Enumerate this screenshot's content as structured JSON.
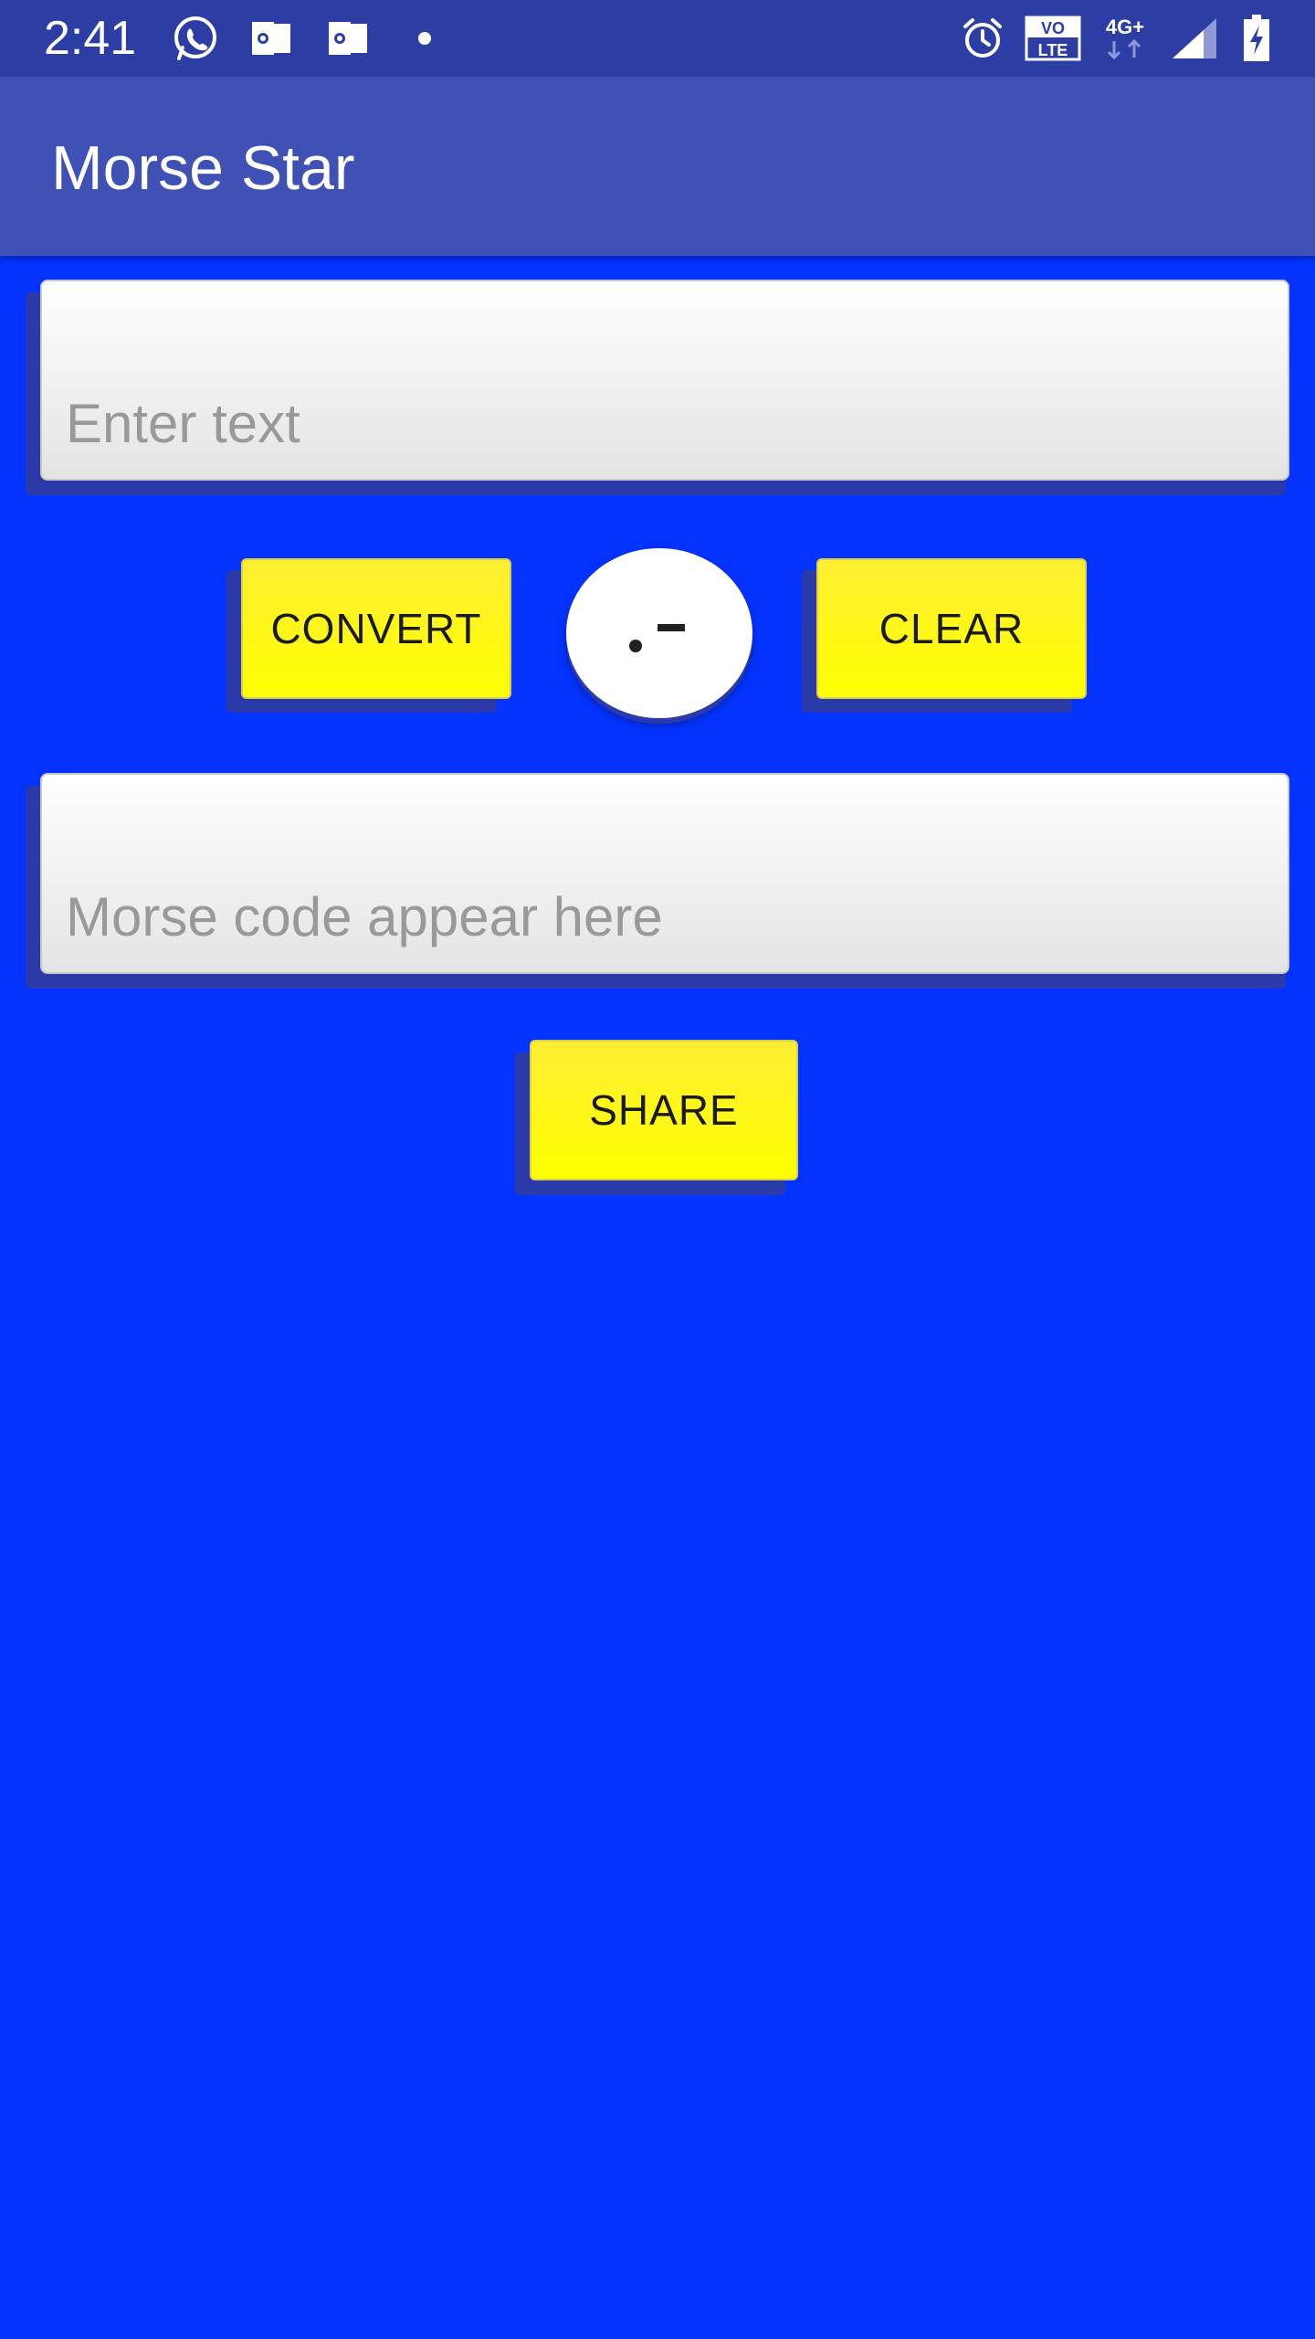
{
  "status_bar": {
    "time": "2:41",
    "icons": [
      "whatsapp-icon",
      "outlook-icon",
      "outlook-icon",
      "dot-icon",
      "alarm-icon",
      "volte-icon",
      "4g-plus-icon",
      "signal-icon",
      "battery-charging-icon"
    ],
    "volte_top": "VO",
    "volte_bottom": "LTE",
    "network": "4G+"
  },
  "app_bar": {
    "title": "Morse Star"
  },
  "input_field": {
    "value": "",
    "placeholder": "Enter text"
  },
  "buttons": {
    "convert_label": "CONVERT",
    "clear_label": "CLEAR",
    "share_label": "SHARE",
    "morse_toggle_icon": "dot-dash-icon"
  },
  "output_field": {
    "value": "",
    "placeholder": "Morse code appear here"
  },
  "colors": {
    "background": "#0433ff",
    "app_bar": "#3f51b5",
    "status_bar": "#2c3ea3",
    "button": "#ffff00"
  }
}
